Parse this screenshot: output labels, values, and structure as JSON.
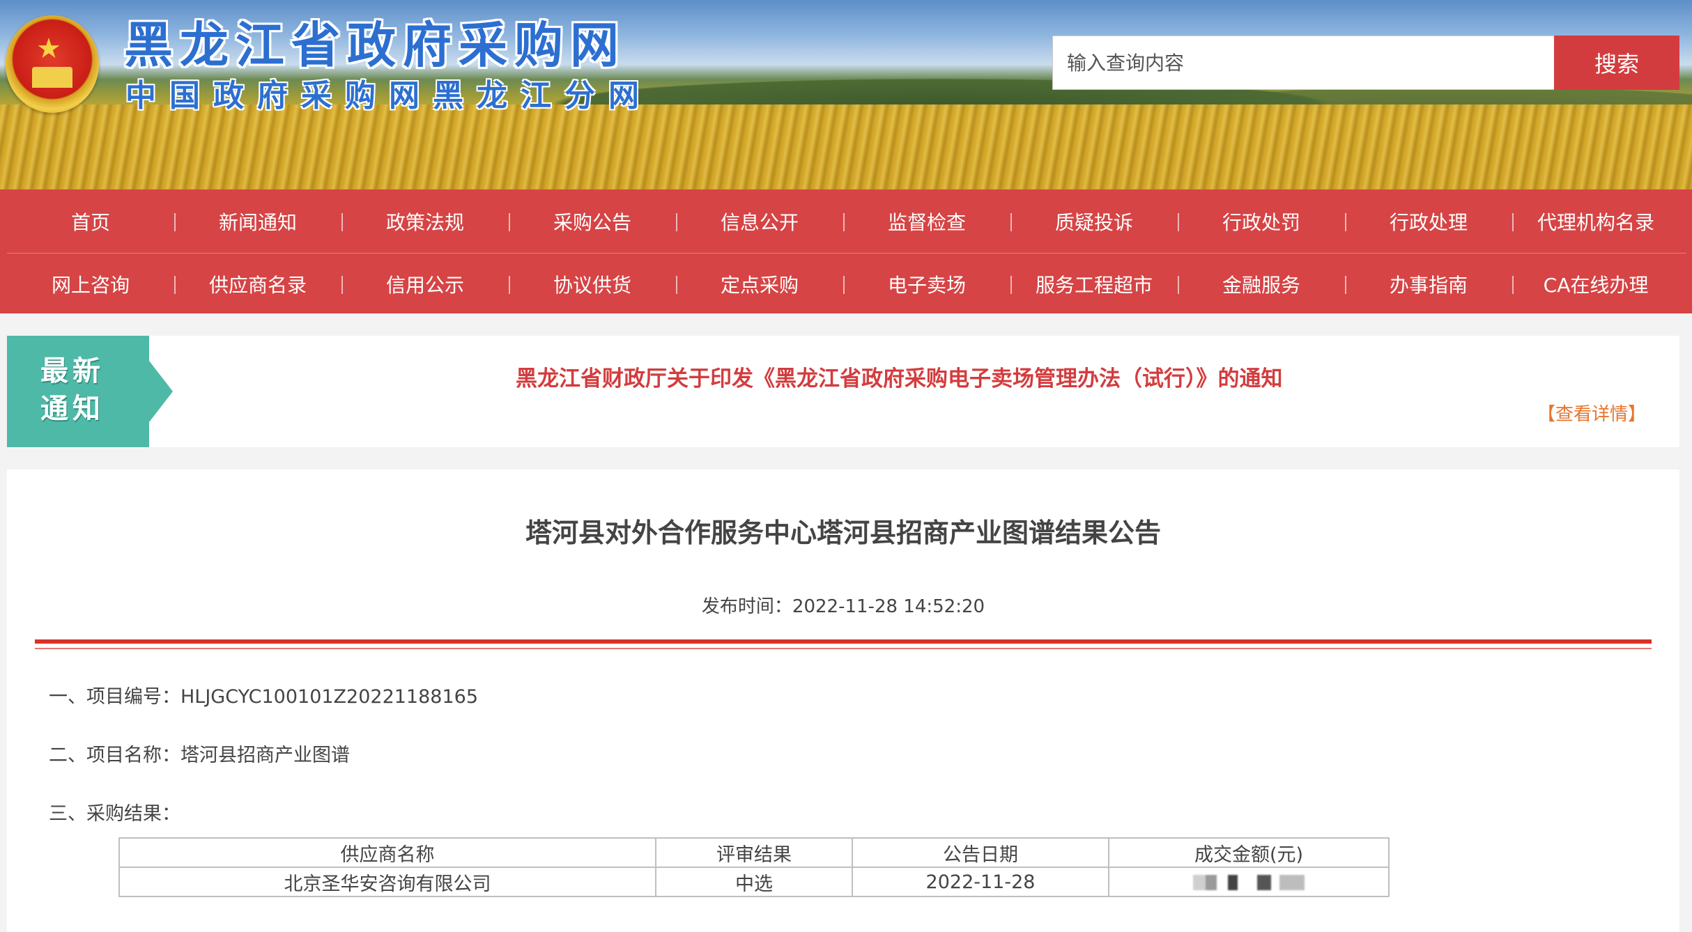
{
  "header": {
    "site_title": "黑龙江省政府采购网",
    "site_subtitle": "中国政府采购网黑龙江分网",
    "search_placeholder": "输入查询内容",
    "search_button": "搜索"
  },
  "nav": {
    "row1": [
      "首页",
      "新闻通知",
      "政策法规",
      "采购公告",
      "信息公开",
      "监督检查",
      "质疑投诉",
      "行政处罚",
      "行政处理",
      "代理机构名录"
    ],
    "row2": [
      "网上咨询",
      "供应商名录",
      "信用公示",
      "协议供货",
      "定点采购",
      "电子卖场",
      "服务工程超市",
      "金融服务",
      "办事指南",
      "CA在线办理"
    ]
  },
  "notice": {
    "badge_line1": "最新",
    "badge_line2": "通知",
    "title": "黑龙江省财政厅关于印发《黑龙江省政府采购电子卖场管理办法（试行）》的通知",
    "more": "【查看详情】"
  },
  "article": {
    "title": "塔河县对外合作服务中心塔河县招商产业图谱结果公告",
    "publish_time": "发布时间：2022-11-28 14:52:20",
    "project_no": "一、项目编号：HLJGCYC100101Z20221188165",
    "project_name": "二、项目名称：塔河县招商产业图谱",
    "result_heading": "三、采购结果：",
    "table": {
      "headers": [
        "供应商名称",
        "评审结果",
        "公告日期",
        "成交金额(元)"
      ],
      "rows": [
        {
          "supplier": "北京圣华安咨询有限公司",
          "result": "中选",
          "date": "2022-11-28",
          "amount": ""
        }
      ]
    }
  }
}
